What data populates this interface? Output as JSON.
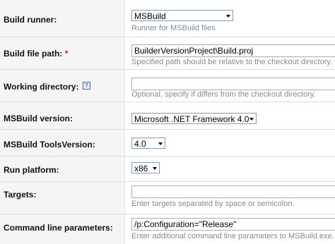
{
  "build_runner": {
    "label": "Build runner:",
    "value": "MSBuild",
    "note": "Runner for MSBuild files"
  },
  "build_file_path": {
    "label": "Build file path:",
    "required_mark": "*",
    "value": "BuilderVersionProject\\Build.proj",
    "note": "Specified path should be relative to the checkout directory."
  },
  "working_directory": {
    "label": "Working directory:",
    "help_icon": "?",
    "value": "",
    "note": "Optional, specify if differs from the checkout directory."
  },
  "msbuild_version": {
    "label": "MSBuild version:",
    "value": "Microsoft .NET Framework 4.0"
  },
  "tools_version": {
    "label": "MSBuild ToolsVersion:",
    "value": "4.0"
  },
  "run_platform": {
    "label": "Run platform:",
    "value": "x86"
  },
  "targets": {
    "label": "Targets:",
    "value": "",
    "note": "Enter targets separated by space or semicolon."
  },
  "command_line": {
    "label": "Command line parameters:",
    "value": "/p:Configuration=\"Release\"",
    "note": "Enter additional command line parameters to MSBuild.exe."
  }
}
